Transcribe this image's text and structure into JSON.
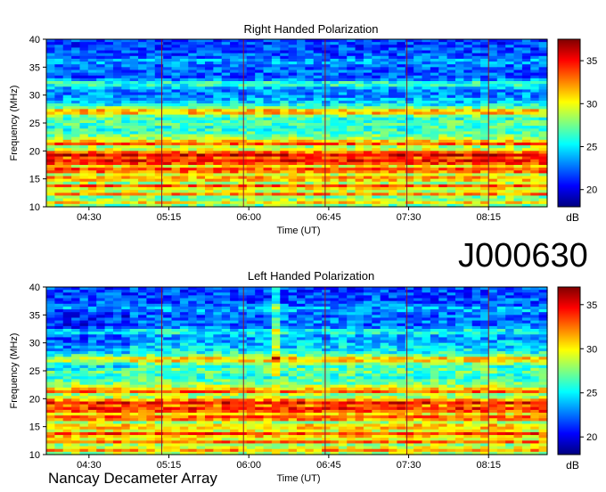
{
  "station_id": "J000630",
  "observatory": "Nancay Decameter Array",
  "colors": {
    "background": "#00008f",
    "colormap": [
      "#00007f",
      "#0000ff",
      "#007fff",
      "#00ffff",
      "#7fff7f",
      "#ffff00",
      "#ff7f00",
      "#ff0000",
      "#7f0000"
    ]
  },
  "chart_data": [
    {
      "type": "heatmap",
      "title": "Right Handed Polarization",
      "xlabel": "Time (UT)",
      "ylabel": "Frequency (MHz)",
      "x_ticks": [
        "04:30",
        "05:15",
        "06:00",
        "06:45",
        "07:30",
        "08:15"
      ],
      "x_tick_minutes": [
        270,
        315,
        360,
        405,
        450,
        495
      ],
      "xlim_minutes": [
        246,
        528
      ],
      "y_ticks": [
        10,
        15,
        20,
        25,
        30,
        35,
        40
      ],
      "ylim": [
        10,
        40
      ],
      "colorbar": {
        "label": "dB",
        "ticks": [
          20,
          25,
          30,
          35
        ],
        "range": [
          18,
          37.5
        ]
      },
      "band_profile": [
        [
          10,
          26
        ],
        [
          10.8,
          31
        ],
        [
          11.6,
          26
        ],
        [
          12.3,
          33
        ],
        [
          13,
          27
        ],
        [
          13.6,
          35
        ],
        [
          14.3,
          28
        ],
        [
          15,
          33
        ],
        [
          15.8,
          29
        ],
        [
          16.5,
          35
        ],
        [
          17.3,
          30
        ],
        [
          18,
          36
        ],
        [
          18.7,
          33
        ],
        [
          19.3,
          36
        ],
        [
          20,
          31
        ],
        [
          20.6,
          27
        ],
        [
          21.3,
          34
        ],
        [
          22,
          29
        ],
        [
          23,
          27
        ],
        [
          24,
          26
        ],
        [
          25,
          27
        ],
        [
          26,
          26
        ],
        [
          27,
          33
        ],
        [
          28,
          26
        ],
        [
          29,
          24
        ],
        [
          30,
          23
        ],
        [
          31,
          23
        ],
        [
          32,
          27
        ],
        [
          33,
          22
        ],
        [
          34,
          22.5
        ],
        [
          35,
          22
        ],
        [
          36,
          24
        ],
        [
          37,
          22
        ],
        [
          40,
          21.5
        ]
      ],
      "vertical_lines_minutes": [
        311,
        357,
        403,
        449,
        495
      ]
    },
    {
      "type": "heatmap",
      "title": "Left Handed Polarization",
      "xlabel": "Time (UT)",
      "ylabel": "Frequency (MHz)",
      "x_ticks": [
        "04:30",
        "05:15",
        "06:00",
        "06:45",
        "07:30",
        "08:15"
      ],
      "x_tick_minutes": [
        270,
        315,
        360,
        405,
        450,
        495
      ],
      "xlim_minutes": [
        246,
        528
      ],
      "y_ticks": [
        10,
        15,
        20,
        25,
        30,
        35,
        40
      ],
      "ylim": [
        10,
        40
      ],
      "colorbar": {
        "label": "dB",
        "ticks": [
          20,
          25,
          30,
          35
        ],
        "range": [
          18,
          37
        ]
      },
      "band_profile": [
        [
          10,
          27
        ],
        [
          10.8,
          32
        ],
        [
          11.6,
          27
        ],
        [
          12.3,
          33
        ],
        [
          13,
          28
        ],
        [
          13.6,
          35
        ],
        [
          14.3,
          29
        ],
        [
          15,
          32
        ],
        [
          15.8,
          28
        ],
        [
          16.5,
          34
        ],
        [
          17.3,
          30
        ],
        [
          18,
          35
        ],
        [
          18.7,
          32
        ],
        [
          19.3,
          35
        ],
        [
          20,
          30
        ],
        [
          20.6,
          27
        ],
        [
          21.3,
          33
        ],
        [
          22,
          29
        ],
        [
          23,
          27
        ],
        [
          24,
          26
        ],
        [
          25,
          27
        ],
        [
          26,
          26
        ],
        [
          27,
          32
        ],
        [
          28,
          26
        ],
        [
          29,
          24.5
        ],
        [
          30,
          24
        ],
        [
          31,
          23
        ],
        [
          32,
          26
        ],
        [
          33,
          22
        ],
        [
          34,
          23
        ],
        [
          35,
          22
        ],
        [
          36,
          24
        ],
        [
          37,
          22
        ],
        [
          40,
          21.5
        ]
      ],
      "vertical_lines_minutes": [
        311,
        357,
        403,
        449,
        495
      ]
    }
  ]
}
